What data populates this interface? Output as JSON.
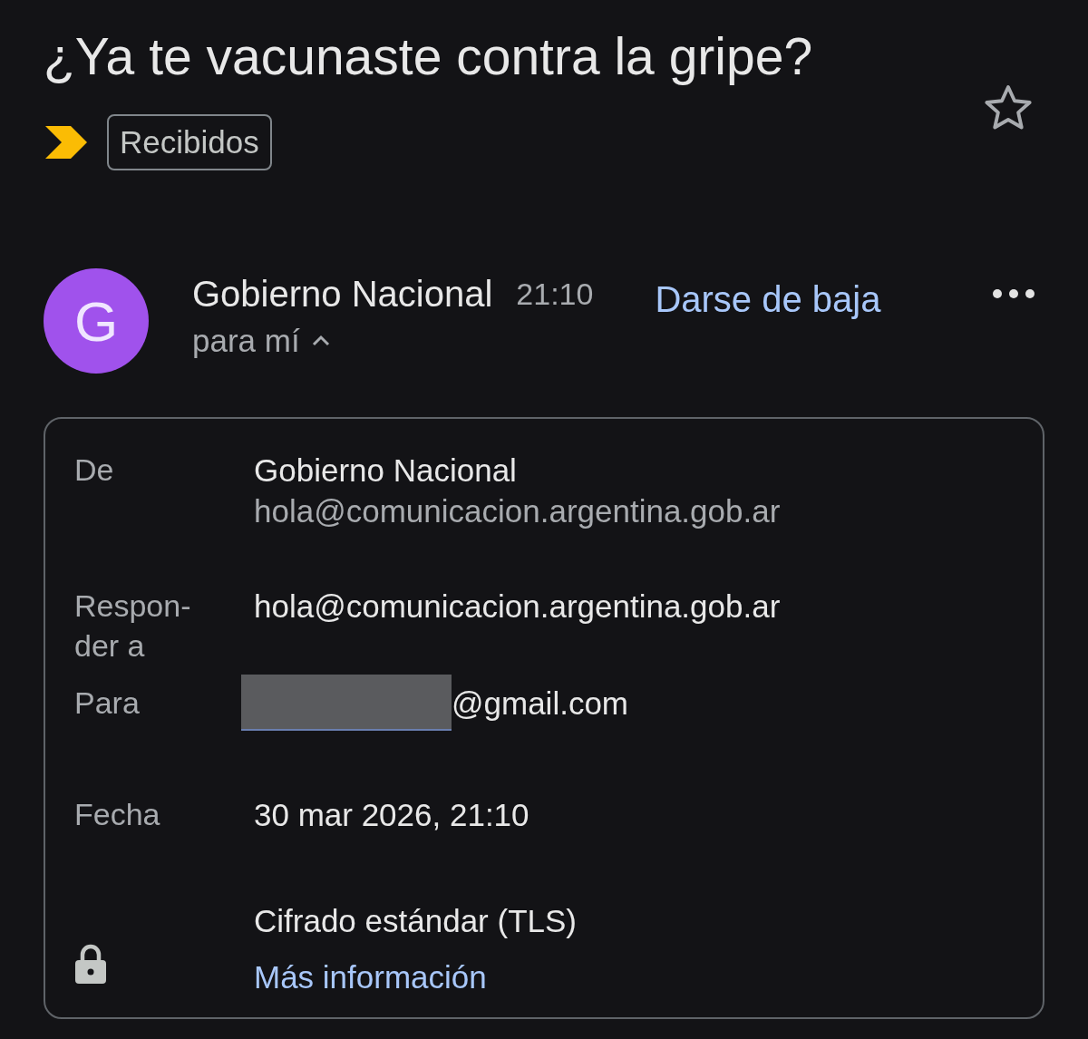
{
  "subject": "¿Ya te vacunaste contra la gripe?",
  "label": "Recibidos",
  "starred": false,
  "sender": {
    "avatar_letter": "G",
    "name": "Gobierno Nacional",
    "time": "21:10",
    "unsubscribe": "Darse de baja",
    "recipients": "para mí",
    "expanded": true
  },
  "details": [
    {
      "kind": "text",
      "label": "De",
      "lines": [
        "Gobierno Nacional",
        "hola@comunicacion.argentina.gob.ar"
      ]
    },
    {
      "kind": "text",
      "label": "Respon-der a",
      "lines": [
        "hola@comunicacion.argentina.gob.ar"
      ]
    },
    {
      "kind": "redacted",
      "label": "Para",
      "lines": [
        "@gmail.com"
      ]
    },
    {
      "kind": "text",
      "label": "Fecha",
      "lines": [
        "30 mar 2026, 21:10"
      ]
    },
    {
      "kind": "security",
      "lines": [
        "Cifrado estándar (TLS)"
      ],
      "link": "Más información"
    }
  ]
}
